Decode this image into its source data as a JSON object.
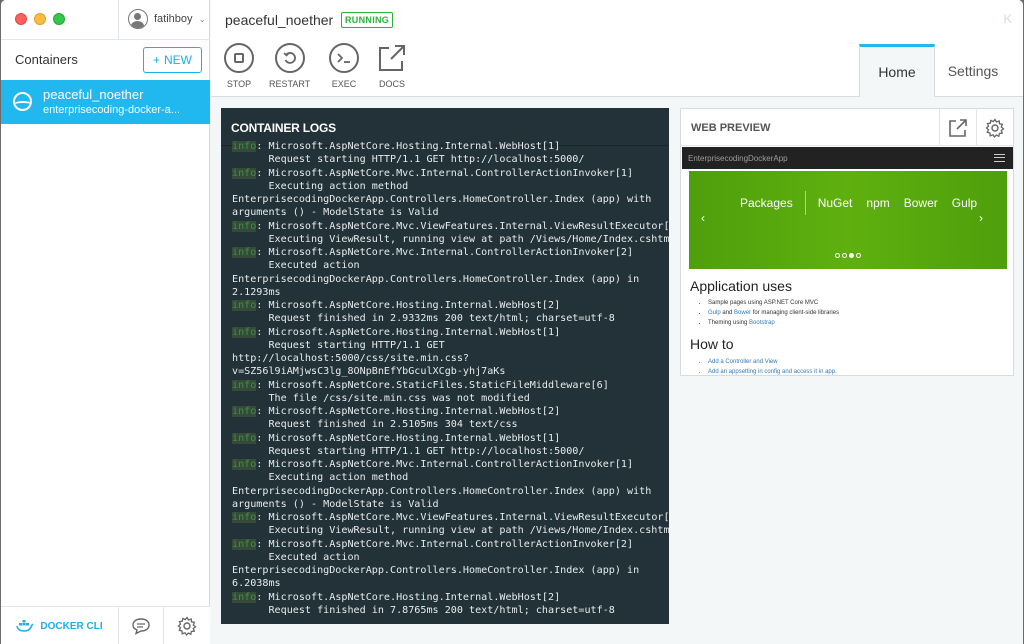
{
  "window": {
    "user": "fatihboy"
  },
  "sidebar": {
    "title": "Containers",
    "new_label": "NEW",
    "containers": [
      {
        "name": "peaceful_noether",
        "image": "enterprisecoding-docker-a..."
      }
    ],
    "docker_cli_label": "DOCKER CLI"
  },
  "header": {
    "container_name": "peaceful_noether",
    "status": "RUNNING",
    "logo": "K",
    "actions": [
      {
        "label": "STOP",
        "icon": "stop-icon"
      },
      {
        "label": "RESTART",
        "icon": "restart-icon"
      },
      {
        "label": "EXEC",
        "icon": "exec-icon"
      },
      {
        "label": "DOCS",
        "icon": "docs-icon"
      }
    ],
    "tabs": [
      {
        "label": "Home",
        "active": true
      },
      {
        "label": "Settings",
        "active": false
      }
    ]
  },
  "logs": {
    "title": "CONTAINER LOGS",
    "lines": [
      "info: Microsoft.AspNetCore.Hosting.Internal.WebHost[1]",
      "      Request starting HTTP/1.1 GET http://localhost:5000/",
      "info: Microsoft.AspNetCore.Mvc.Internal.ControllerActionInvoker[1]",
      "      Executing action method",
      "EnterprisecodingDockerApp.Controllers.HomeController.Index (app) with",
      "arguments () - ModelState is Valid",
      "info: Microsoft.AspNetCore.Mvc.ViewFeatures.Internal.ViewResultExecutor[1]",
      "      Executing ViewResult, running view at path /Views/Home/Index.cshtml.",
      "info: Microsoft.AspNetCore.Mvc.Internal.ControllerActionInvoker[2]",
      "      Executed action",
      "EnterprisecodingDockerApp.Controllers.HomeController.Index (app) in",
      "2.1293ms",
      "info: Microsoft.AspNetCore.Hosting.Internal.WebHost[2]",
      "      Request finished in 2.9332ms 200 text/html; charset=utf-8",
      "info: Microsoft.AspNetCore.Hosting.Internal.WebHost[1]",
      "      Request starting HTTP/1.1 GET",
      "http://localhost:5000/css/site.min.css?",
      "v=SZ56l9iAMjwsC3lg_8ONpBnEfYbGculXCgb-yhj7aKs",
      "info: Microsoft.AspNetCore.StaticFiles.StaticFileMiddleware[6]",
      "      The file /css/site.min.css was not modified",
      "info: Microsoft.AspNetCore.Hosting.Internal.WebHost[2]",
      "      Request finished in 2.5105ms 304 text/css",
      "info: Microsoft.AspNetCore.Hosting.Internal.WebHost[1]",
      "      Request starting HTTP/1.1 GET http://localhost:5000/",
      "info: Microsoft.AspNetCore.Mvc.Internal.ControllerActionInvoker[1]",
      "      Executing action method",
      "EnterprisecodingDockerApp.Controllers.HomeController.Index (app) with",
      "arguments () - ModelState is Valid",
      "info: Microsoft.AspNetCore.Mvc.ViewFeatures.Internal.ViewResultExecutor[1]",
      "      Executing ViewResult, running view at path /Views/Home/Index.cshtml.",
      "info: Microsoft.AspNetCore.Mvc.Internal.ControllerActionInvoker[2]",
      "      Executed action",
      "EnterprisecodingDockerApp.Controllers.HomeController.Index (app) in",
      "6.2038ms",
      "info: Microsoft.AspNetCore.Hosting.Internal.WebHost[2]",
      "      Request finished in 7.8765ms 200 text/html; charset=utf-8"
    ]
  },
  "preview": {
    "title": "WEB PREVIEW",
    "site": {
      "brand": "EnterprisecodingDockerApp",
      "carousel": [
        "Packages",
        "NuGet",
        "npm",
        "Bower",
        "Gulp"
      ],
      "section1_title": "Application uses",
      "section1_items": [
        [
          "Sample pages using ASP.NET Core MVC"
        ],
        [
          "Gulp",
          " and ",
          "Bower",
          " for managing client-side libraries"
        ],
        [
          "Theming using ",
          "Bootstrap"
        ]
      ],
      "section2_title": "How to",
      "section2_items": [
        "Add a Controller and View",
        "Add an appsetting in config and access it in app."
      ]
    }
  },
  "colors": {
    "accent": "#21b8ef",
    "running": "#28b43a",
    "log_bg": "#233138"
  }
}
